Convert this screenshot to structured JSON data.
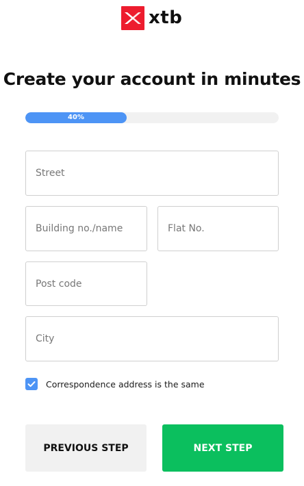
{
  "brand": {
    "name": "xtb",
    "logo_color": "#ed1c2e"
  },
  "page": {
    "title": "Create your account in minutes"
  },
  "progress": {
    "value_percent": 40,
    "label": "40%",
    "color": "#4d94f5"
  },
  "form": {
    "street": {
      "placeholder": "Street",
      "value": ""
    },
    "building": {
      "placeholder": "Building no./name",
      "value": ""
    },
    "flat": {
      "placeholder": "Flat No.",
      "value": ""
    },
    "postcode": {
      "placeholder": "Post code",
      "value": ""
    },
    "city": {
      "placeholder": "City",
      "value": ""
    },
    "correspondence_same": {
      "label": "Correspondence address is the same",
      "checked": true
    }
  },
  "actions": {
    "previous_label": "PREVIOUS STEP",
    "next_label": "NEXT STEP",
    "next_color": "#0bbf5e"
  },
  "icons": {
    "logo": "xtb-logo-icon",
    "checkbox_check": "check-icon"
  }
}
